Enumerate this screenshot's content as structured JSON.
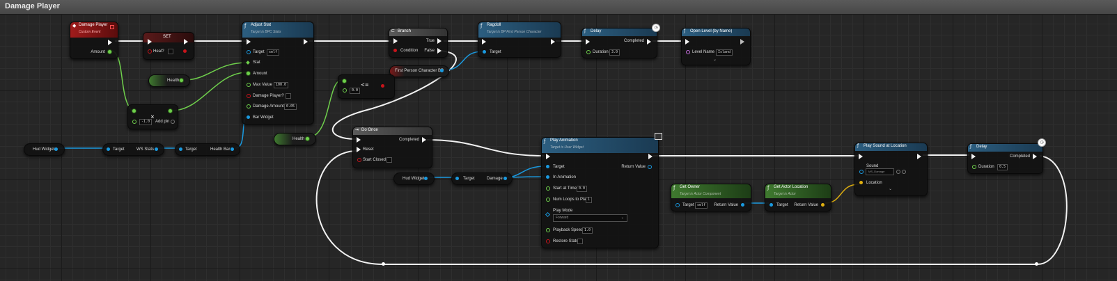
{
  "graph_title": "Damage Player",
  "nodes": {
    "damage_player": {
      "title": "Damage Player",
      "subtitle": "Custom Event",
      "pins": {
        "amount": "Amount"
      }
    },
    "set": {
      "title": "SET",
      "pins": {
        "heal": "Heal?"
      }
    },
    "adjust_stat": {
      "title": "Adjust Stat",
      "subtitle": "Target is BPC Stats",
      "pins": {
        "target": "Target",
        "target_value": "self",
        "stat": "Stat",
        "amount": "Amount",
        "max_value": "Max Value",
        "max_value_val": "100.0",
        "damage_player": "Damage Player?",
        "damage_amount": "Damage Amount",
        "damage_amount_val": "0.05",
        "bar_widget": "Bar Widget"
      }
    },
    "health_get_1": {
      "label": "Health"
    },
    "multiply": {
      "value": "-1.0",
      "add_pin": "Add pin"
    },
    "hud_widget_1": {
      "label": "Hud Widget"
    },
    "ws_stats": {
      "target": "Target",
      "output": "WS Stats"
    },
    "health_bar": {
      "target": "Target",
      "output": "Health Bar"
    },
    "branch": {
      "title": "Branch",
      "pins": {
        "condition": "Condition",
        "true": "True",
        "false": "False"
      }
    },
    "less_equal": {
      "op": "<=",
      "value": "0.0"
    },
    "first_person_bp": {
      "label": "First Person Character BP"
    },
    "health_get_2": {
      "label": "Health"
    },
    "do_once": {
      "title": "Do Once",
      "pins": {
        "completed": "Completed",
        "reset": "Reset",
        "start_closed": "Start Closed"
      }
    },
    "ragdoll": {
      "title": "Ragdoll",
      "subtitle": "Target is BP First Person Character",
      "pins": {
        "target": "Target"
      }
    },
    "delay_1": {
      "title": "Delay",
      "pins": {
        "completed": "Completed",
        "duration": "Duration",
        "duration_val": "3.0"
      }
    },
    "open_level": {
      "title": "Open Level (by Name)",
      "pins": {
        "level_name": "Level Name",
        "level_name_val": "Island"
      }
    },
    "play_animation": {
      "title": "Play Animation",
      "subtitle": "Target is User Widget",
      "pins": {
        "target": "Target",
        "in_animation": "In Animation",
        "start_at_time": "Start at Time",
        "start_at_time_val": "0.0",
        "num_loops": "Num Loops to Play",
        "num_loops_val": "1",
        "play_mode": "Play Mode",
        "play_mode_val": "Forward",
        "playback_speed": "Playback Speed",
        "playback_speed_val": "1.0",
        "restore_state": "Restore State",
        "return_value": "Return Value"
      }
    },
    "hud_widget_2": {
      "label": "Hud Widget"
    },
    "damage_get": {
      "target": "Target",
      "output": "Damage"
    },
    "get_owner": {
      "title": "Get Owner",
      "subtitle": "Target is Actor Component",
      "pins": {
        "target": "Target",
        "target_val": "self",
        "return_value": "Return Value"
      }
    },
    "get_actor_location": {
      "title": "Get Actor Location",
      "subtitle": "Target is Actor",
      "pins": {
        "target": "Target",
        "return_value": "Return Value"
      }
    },
    "play_sound": {
      "title": "Play Sound at Location",
      "pins": {
        "sound": "Sound",
        "sound_val": "MS_Damage",
        "location": "Location"
      }
    },
    "delay_2": {
      "title": "Delay",
      "pins": {
        "completed": "Completed",
        "duration": "Duration",
        "duration_val": "0.5"
      }
    }
  },
  "colors": {
    "exec_wire": "#f2f2f2",
    "float_wire": "#6fd04c",
    "object_wire": "#1a9ae0",
    "vector_wire": "#e0b010",
    "event_header": "#9e1a1a",
    "function_header": "#2c5e80",
    "pure_header": "#3f7a2f",
    "macro_header": "#555555"
  }
}
